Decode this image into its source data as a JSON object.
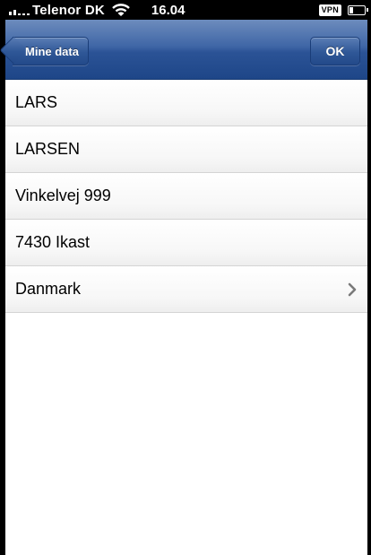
{
  "status_bar": {
    "carrier": "Telenor DK",
    "time": "16.04",
    "vpn_label": "VPN",
    "icons": [
      "signal-icon",
      "wifi-icon",
      "battery-icon"
    ]
  },
  "nav": {
    "back_label": "Mine data",
    "ok_label": "OK"
  },
  "rows": [
    {
      "value": "LARS",
      "has_disclosure": false
    },
    {
      "value": "LARSEN",
      "has_disclosure": false
    },
    {
      "value": "Vinkelvej 999",
      "has_disclosure": false
    },
    {
      "value": "7430 Ikast",
      "has_disclosure": false
    },
    {
      "value": "Danmark",
      "has_disclosure": true
    }
  ],
  "colors": {
    "nav_bar": "#2b5396",
    "status_bar": "#000000",
    "background": "#ffffff",
    "chevron": "#7a7a7a"
  }
}
